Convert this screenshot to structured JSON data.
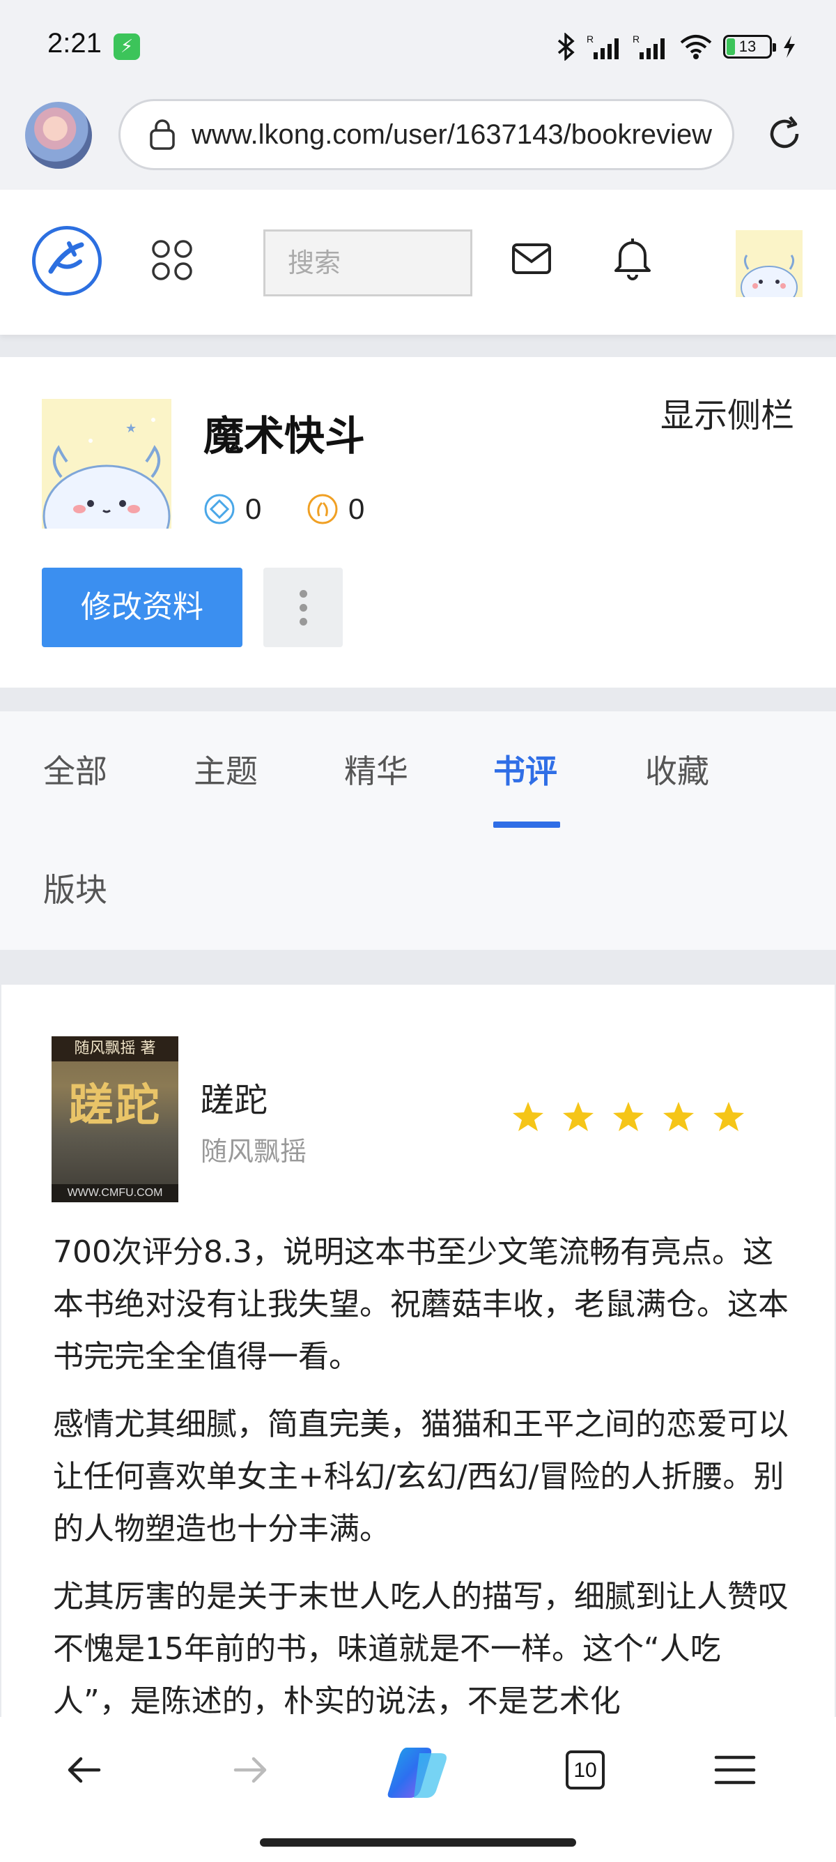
{
  "status_bar": {
    "time": "2:21",
    "battery": "13"
  },
  "browser": {
    "url": "www.lkong.com/user/1637143/bookreview",
    "tab_count": "10"
  },
  "header": {
    "search_placeholder": "搜索"
  },
  "profile": {
    "username": "魔术快斗",
    "sidebar_toggle": "显示侧栏",
    "stat_diamond": "0",
    "stat_coin": "0",
    "edit_button": "修改资料"
  },
  "tabs": {
    "items": [
      "全部",
      "主题",
      "精华",
      "书评",
      "收藏",
      "版块"
    ],
    "active": "书评"
  },
  "review": {
    "cover_band": "随风飘摇 著",
    "cover_title": "蹉跎",
    "cover_footer": "WWW.CMFU.COM",
    "book_title": "蹉跎",
    "author": "随风飘摇",
    "rating_stars": 5,
    "paragraphs": [
      "700次评分8.3，说明这本书至少文笔流畅有亮点。这本书绝对没有让我失望。祝蘑菇丰收，老鼠满仓。这本书完完全全值得一看。",
      "感情尤其细腻，简直完美，猫猫和王平之间的恋爱可以让任何喜欢单女主+科幻/玄幻/西幻/冒险的人折腰。别的人物塑造也十分丰满。",
      "尤其厉害的是关于末世人吃人的描写，细腻到让人赞叹不愧是15年前的书，味道就是不一样。这个“人吃人”，是陈述的，朴实的说法，不是艺术化"
    ]
  },
  "colors": {
    "accent": "#2f6ee6",
    "button": "#3b8ff0",
    "star": "#f5c518"
  }
}
